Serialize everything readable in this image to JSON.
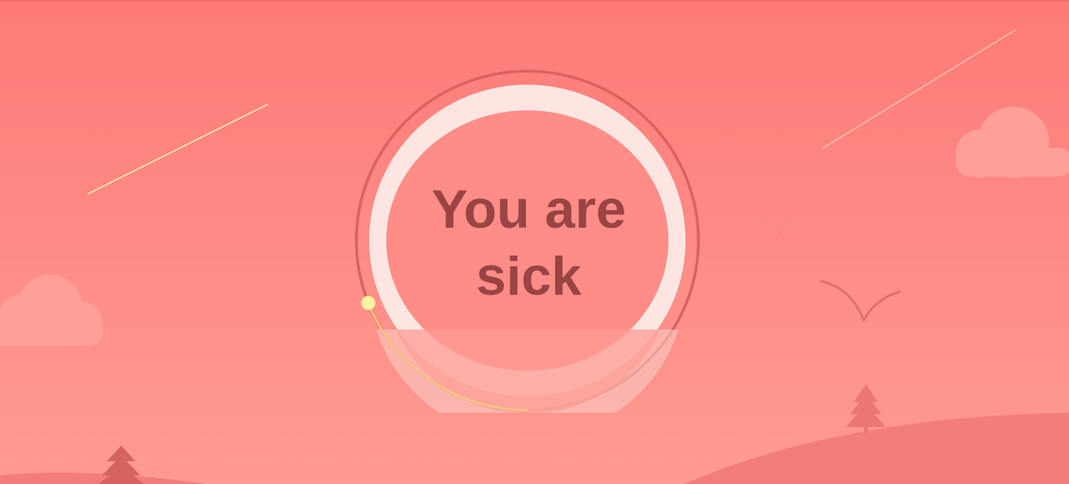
{
  "status": {
    "label": "You are sick"
  },
  "progress": {
    "fraction": 0.19
  },
  "colors": {
    "background_top": "#fe7a77",
    "background_bottom": "#fe9b92",
    "ring_outline": "#d96262",
    "ring_inner": "#fde6e2",
    "status_text": "#9a4444",
    "progress_arc": "#f5c67e",
    "progress_knob": "#fbf3a6",
    "cloud": "#fe9f98",
    "hill": "#f37d78",
    "tree": "#d66360"
  },
  "icons": [
    "cloud-icon",
    "tree-icon",
    "bird-icon",
    "shooting-star-icon",
    "progress-knob-icon"
  ]
}
